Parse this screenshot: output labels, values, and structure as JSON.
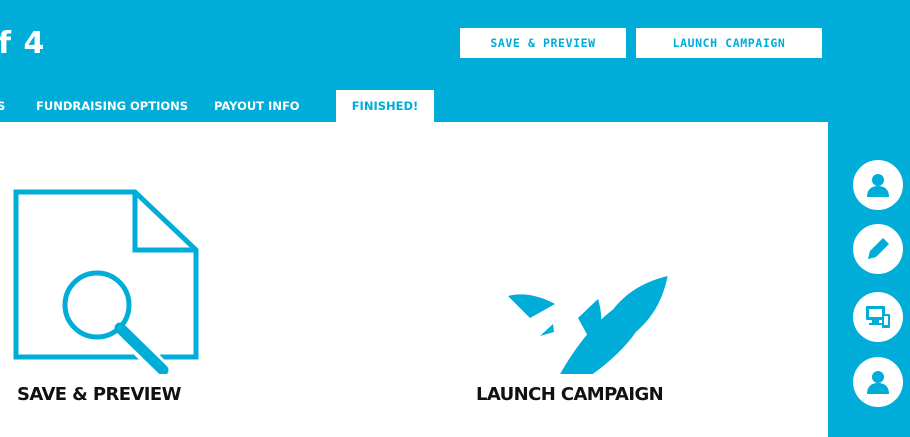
{
  "header": {
    "step_title_fragment": "f 4",
    "save_preview_button": "SAVE & PREVIEW",
    "launch_campaign_button": "LAUNCH CAMPAIGN"
  },
  "tabs": [
    {
      "label": "S",
      "active": false
    },
    {
      "label": "FUNDRAISING OPTIONS",
      "active": false
    },
    {
      "label": "PAYOUT INFO",
      "active": false
    },
    {
      "label": "FINISHED!",
      "active": true
    }
  ],
  "cards": {
    "save_preview": {
      "label": "SAVE & PREVIEW",
      "icon": "document-magnifier-icon"
    },
    "launch_campaign": {
      "label": "LAUNCH CAMPAIGN",
      "icon": "rocket-icon"
    }
  },
  "side_icons": [
    "user-icon",
    "pencil-icon",
    "devices-icon",
    "user-icon"
  ],
  "colors": {
    "accent": "#00acd8",
    "background": "#ffffff",
    "text": "#111111"
  }
}
